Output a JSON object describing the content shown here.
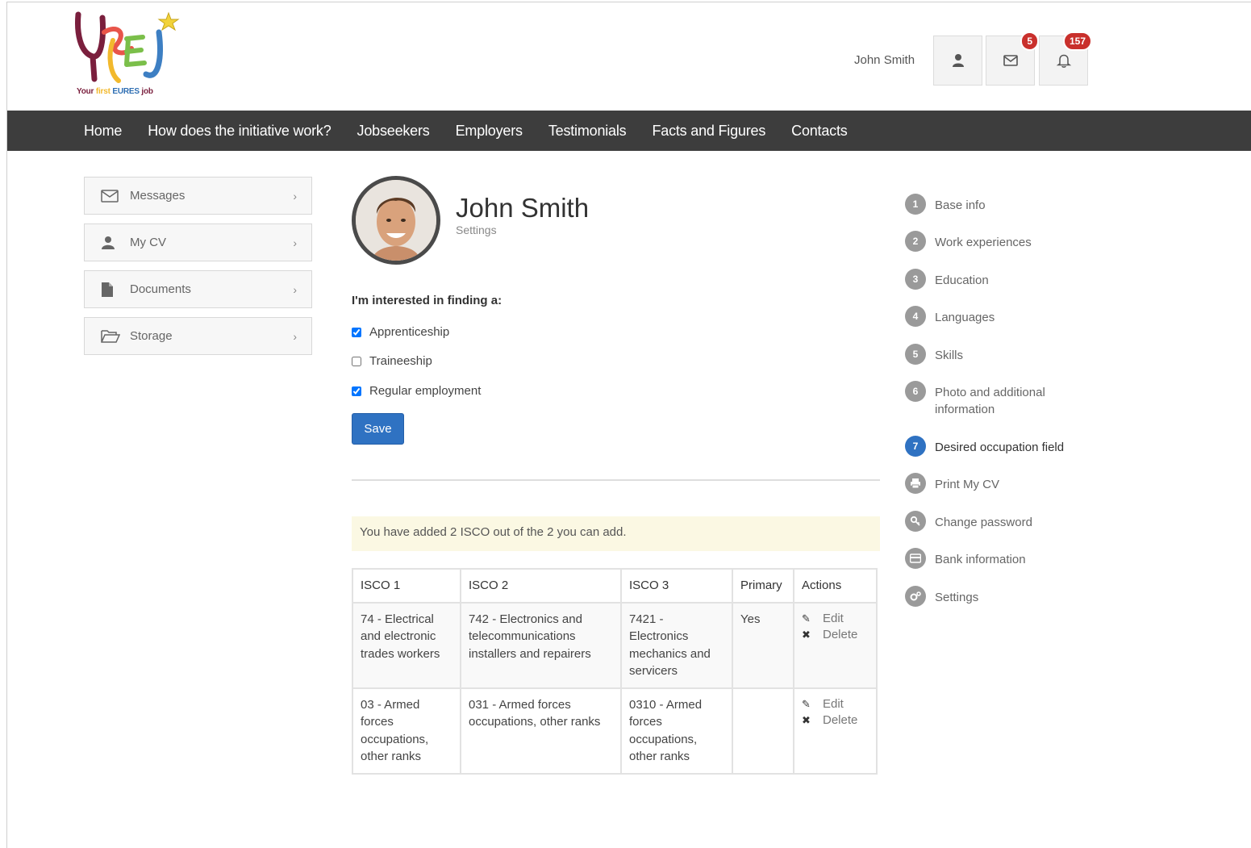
{
  "header": {
    "logo_text_prefix": "Your",
    "logo_text_first": "first",
    "logo_text_eures": "EURES",
    "logo_text_job": "job",
    "user_name": "John Smith",
    "messages_badge": "5",
    "notifications_badge": "157"
  },
  "nav": {
    "items": [
      "Home",
      "How does the initiative work?",
      "Jobseekers",
      "Employers",
      "Testimonials",
      "Facts and Figures",
      "Contacts"
    ]
  },
  "sidebar": {
    "items": [
      {
        "label": "Messages",
        "icon": "envelope-icon"
      },
      {
        "label": "My CV",
        "icon": "user-icon"
      },
      {
        "label": "Documents",
        "icon": "file-icon"
      },
      {
        "label": "Storage",
        "icon": "folder-open-icon"
      }
    ]
  },
  "profile": {
    "name": "John Smith",
    "subtitle": "Settings"
  },
  "form": {
    "interest_label": "I'm interested in finding a:",
    "options": [
      {
        "label": "Apprenticeship",
        "checked": true
      },
      {
        "label": "Traineeship",
        "checked": false
      },
      {
        "label": "Regular employment",
        "checked": true
      }
    ],
    "save_label": "Save"
  },
  "alert": {
    "text": "You have added 2 ISCO out of the 2 you can add."
  },
  "table": {
    "headers": [
      "ISCO 1",
      "ISCO 2",
      "ISCO 3",
      "Primary",
      "Actions"
    ],
    "rows": [
      {
        "isco1": "74 - Electrical and electronic trades workers",
        "isco2": "742 - Electronics and telecommunications installers and repairers",
        "isco3": "7421 - Electronics mechanics and servicers",
        "primary": "Yes"
      },
      {
        "isco1": "03 - Armed forces occupations, other ranks",
        "isco2": "031 - Armed forces occupations, other ranks",
        "isco3": "0310 - Armed forces occupations, other ranks",
        "primary": ""
      }
    ],
    "edit_label": "Edit",
    "delete_label": "Delete"
  },
  "steps": {
    "items": [
      {
        "num": "1",
        "label": "Base info"
      },
      {
        "num": "2",
        "label": "Work experiences"
      },
      {
        "num": "3",
        "label": "Education"
      },
      {
        "num": "4",
        "label": "Languages"
      },
      {
        "num": "5",
        "label": "Skills"
      },
      {
        "num": "6",
        "label": "Photo and additional information"
      },
      {
        "num": "7",
        "label": "Desired occupation field",
        "active": true
      },
      {
        "num": "",
        "label": "Print My CV",
        "icon": "printer-icon"
      },
      {
        "num": "",
        "label": "Change password",
        "icon": "key-icon"
      },
      {
        "num": "",
        "label": "Bank information",
        "icon": "credit-card-icon"
      },
      {
        "num": "",
        "label": "Settings",
        "icon": "gears-icon"
      }
    ]
  },
  "colors": {
    "nav_bg": "#3d3d3d",
    "primary": "#2f72c2",
    "badge": "#c9302c",
    "alert_bg": "#fbf8e3"
  }
}
